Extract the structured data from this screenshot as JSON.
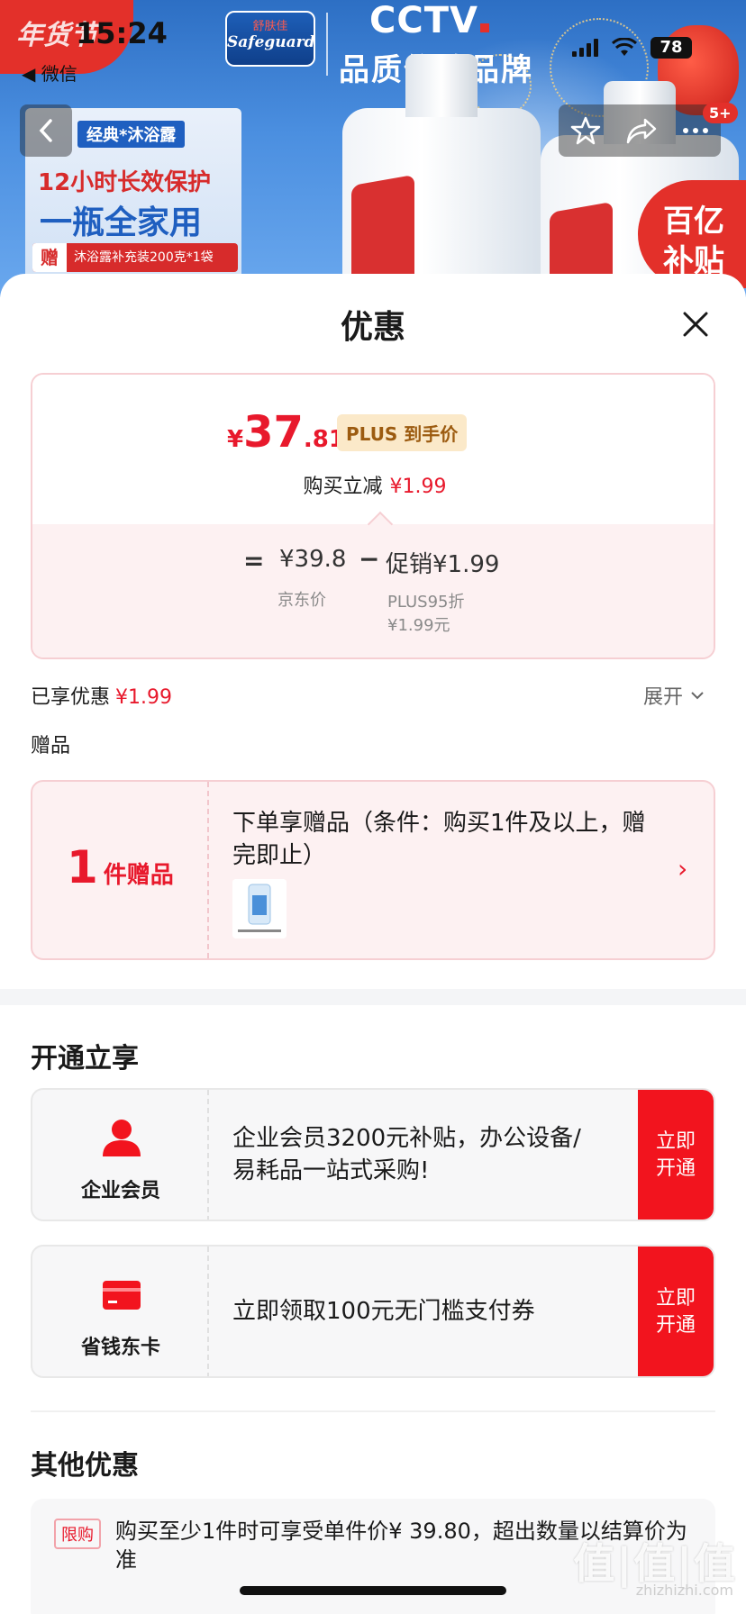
{
  "status_bar": {
    "time": "15:24",
    "back_app": "◀ 微信",
    "battery": "78"
  },
  "banner": {
    "nianhuo": "年货节",
    "safeguard_cn": "舒肤佳",
    "safeguard_en": "Safeguard",
    "cctv": "CCTV",
    "cctv_sub": "品质信赖品牌",
    "ad_tag": "经典*沐浴露",
    "ad_line1": "12小时长效保护",
    "ad_line2": "一瓶全家用",
    "ad_gift_prefix": "赠",
    "ad_gift": "沐浴露补充装200克*1袋",
    "bybt_line1": "百亿",
    "bybt_line2": "补贴"
  },
  "nav": {
    "badge": "5+"
  },
  "sheet": {
    "title": "优惠"
  },
  "price_card": {
    "yen": "¥",
    "price_int": "37",
    "price_dec": ".81",
    "plus_tag": "PLUS 到手价",
    "reduce_label": "购买立减",
    "reduce_amount": "¥1.99",
    "eq": "=",
    "jd_price": "¥39.8",
    "minus": "−",
    "promo": "促销¥1.99",
    "jd_label": "京东价",
    "plus95_line1": "PLUS95折",
    "plus95_line2": "¥1.99元"
  },
  "enjoyed": {
    "label": "已享优惠",
    "amount": "¥1.99",
    "expand": "展开"
  },
  "gift": {
    "section_title": "赠品",
    "count": "1",
    "count_unit": "件赠品",
    "desc": "下单享赠品（条件：购买1件及以上，赠完即止）"
  },
  "open_section": {
    "title": "开通立享",
    "cards": [
      {
        "name": "企业会员",
        "desc": "企业会员3200元补贴，办公设备/易耗品一站式采购!",
        "button": "立即开通"
      },
      {
        "name": "省钱东卡",
        "desc": "立即领取100元无门槛支付券",
        "button": "立即开通"
      }
    ]
  },
  "other_section": {
    "title": "其他优惠",
    "limit_tag": "限购",
    "limit_text": "购买至少1件时可享受单件价¥ 39.80，超出数量以结算价为准"
  },
  "watermark": {
    "main": "值|值|值",
    "sub": "zhizhizhi.com"
  },
  "colors": {
    "accent_red": "#e8192c",
    "button_red": "#f2141e",
    "plus_gold": "#9c5b10"
  }
}
